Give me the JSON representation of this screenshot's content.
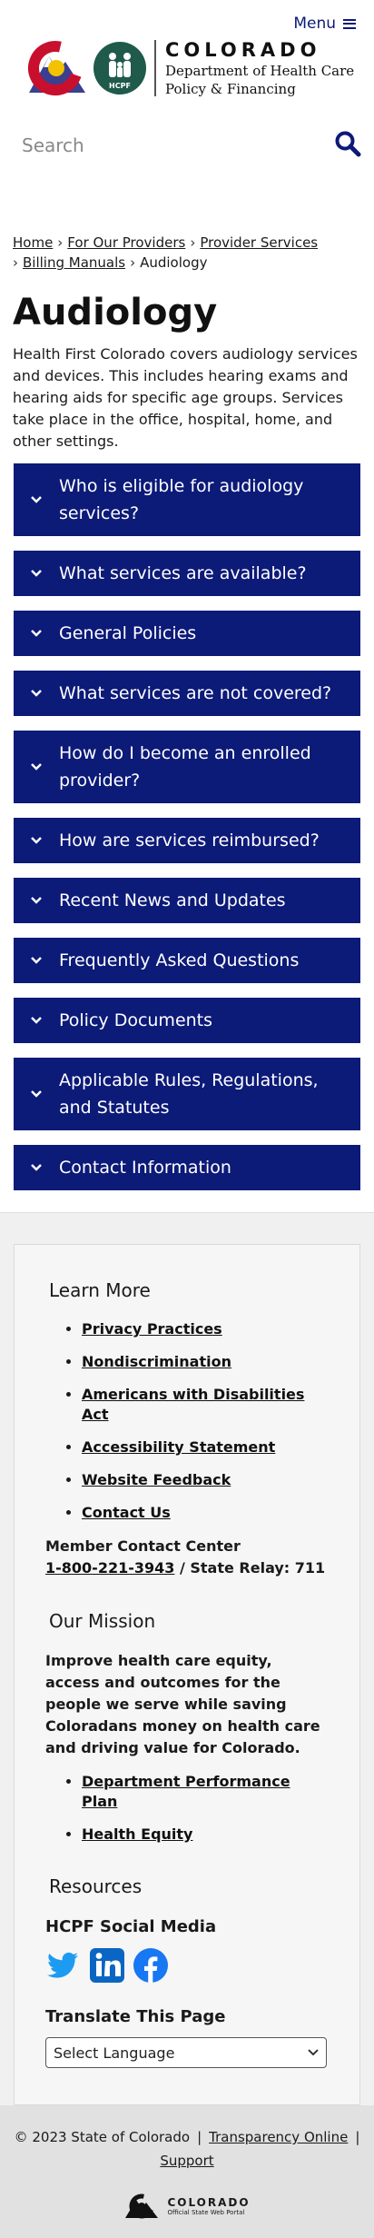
{
  "header": {
    "menu_label": "Menu",
    "logo_line1": "COLORADO",
    "logo_line2": "Department of Health Care",
    "logo_line3": "Policy & Financing",
    "hcpf_badge": "HCPF",
    "search_placeholder": "Search"
  },
  "breadcrumb": {
    "items": [
      "Home",
      "For Our Providers",
      "Provider Services",
      "Billing Manuals",
      "Audiology"
    ]
  },
  "page": {
    "title": "Audiology",
    "intro": "Health First Colorado covers audiology services and devices. This includes hearing exams and hearing aids for specific age groups. Services take place in the office, hospital, home, and other settings."
  },
  "accordions": [
    "Who is eligible for audiology services?",
    "What services are available?",
    "General Policies",
    "What services are not covered?",
    "How do I become an enrolled provider?",
    "How are services reimbursed?",
    "Recent News and Updates",
    "Frequently Asked Questions",
    "Policy Documents",
    "Applicable Rules, Regulations, and Statutes",
    "Contact Information"
  ],
  "footer": {
    "learn_more_heading": "Learn More",
    "learn_more_links": [
      "Privacy Practices",
      "Nondiscrimination",
      "Americans with Disabilities Act",
      "Accessibility Statement",
      "Website Feedback",
      "Contact Us"
    ],
    "contact_center_label": "Member Contact Center",
    "contact_phone": "1-800-221-3943",
    "contact_relay": " / State Relay: 711",
    "mission_heading": "Our Mission",
    "mission_text": "Improve health care equity, access and outcomes for the people we serve while saving Coloradans money on health care and driving value for Colorado.",
    "mission_links": [
      "Department Performance Plan",
      "Health Equity"
    ],
    "resources_heading": "Resources",
    "social_heading": "HCPF Social Media",
    "social_icons": [
      "twitter-icon",
      "linkedin-icon",
      "facebook-icon"
    ],
    "translate_heading": "Translate This Page",
    "translate_select": "Select Language"
  },
  "bottom": {
    "copyright": "© 2023 State of Colorado",
    "divider": "|",
    "link1": "Transparency Online",
    "link2": "Support",
    "portal_line1": "COLORADO",
    "portal_line2": "Official State Web Portal"
  },
  "colors": {
    "brand_navy": "#0c1a78",
    "twitter": "#1d9bf0",
    "linkedin": "#0a66c2",
    "facebook": "#1877f2"
  }
}
